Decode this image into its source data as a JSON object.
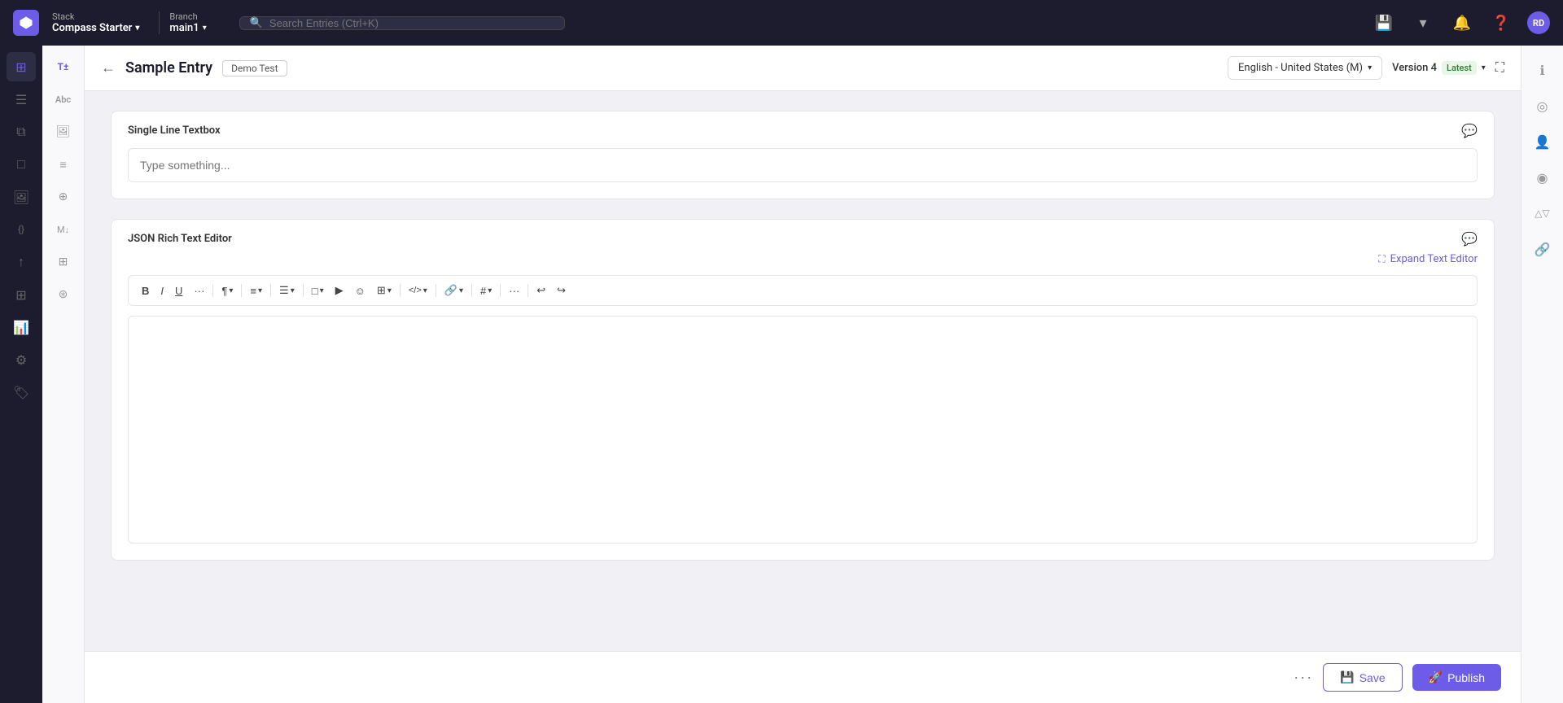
{
  "topnav": {
    "brand_line1": "Stack",
    "brand_line2": "Compass Starter",
    "branch_label": "Branch",
    "branch_name": "main1",
    "search_placeholder": "Search Entries (Ctrl+K)",
    "avatar": "RD"
  },
  "entry": {
    "title": "Sample Entry",
    "tag": "Demo Test",
    "locale": "English - United States (M)",
    "version_label": "Version 4",
    "version_badge": "Latest"
  },
  "fields": {
    "textbox": {
      "label": "Single Line Textbox",
      "placeholder": "Type something..."
    },
    "rte": {
      "label": "JSON Rich Text Editor",
      "expand_label": "Expand Text Editor"
    }
  },
  "toolbar": {
    "bold": "B",
    "italic": "I",
    "underline": "U",
    "more": "···",
    "para": "¶",
    "align": "≡",
    "list": "☰",
    "file": "□",
    "video": "▶",
    "emoji": "☺",
    "table": "⊞",
    "code": "</>",
    "link": "🔗",
    "hash": "#",
    "more2": "···",
    "undo": "↩",
    "redo": "↪"
  },
  "footer": {
    "more_label": "···",
    "save_label": "Save",
    "publish_label": "Publish"
  },
  "sidebar": {
    "icons": [
      {
        "name": "dashboard",
        "symbol": "⊞",
        "active": true
      },
      {
        "name": "list",
        "symbol": "☰"
      },
      {
        "name": "layers",
        "symbol": "⧉"
      },
      {
        "name": "page",
        "symbol": "□"
      },
      {
        "name": "media",
        "symbol": "🖼"
      },
      {
        "name": "bracket",
        "symbol": "{}"
      },
      {
        "name": "upload",
        "symbol": "↑"
      },
      {
        "name": "grid",
        "symbol": "⊞"
      },
      {
        "name": "chart",
        "symbol": "📊"
      },
      {
        "name": "settings",
        "symbol": "⚙"
      },
      {
        "name": "tag",
        "symbol": "🏷"
      }
    ]
  },
  "second_sidebar": {
    "icons": [
      {
        "name": "text-type",
        "symbol": "T"
      },
      {
        "name": "abc",
        "symbol": "Abc"
      },
      {
        "name": "media-icon",
        "symbol": "🖼"
      },
      {
        "name": "text-lines",
        "symbol": "≡"
      },
      {
        "name": "location",
        "symbol": "⊕"
      },
      {
        "name": "markdown",
        "symbol": "M↓"
      },
      {
        "name": "grid2",
        "symbol": "⊞"
      },
      {
        "name": "hierarchy",
        "symbol": "⊛"
      }
    ]
  },
  "right_panel": {
    "icons": [
      {
        "name": "info",
        "symbol": "ℹ"
      },
      {
        "name": "circle-dot",
        "symbol": "◎"
      },
      {
        "name": "person",
        "symbol": "👤"
      },
      {
        "name": "radio",
        "symbol": "◉"
      },
      {
        "name": "compare",
        "symbol": "△▽"
      },
      {
        "name": "link2",
        "symbol": "🔗"
      }
    ]
  }
}
